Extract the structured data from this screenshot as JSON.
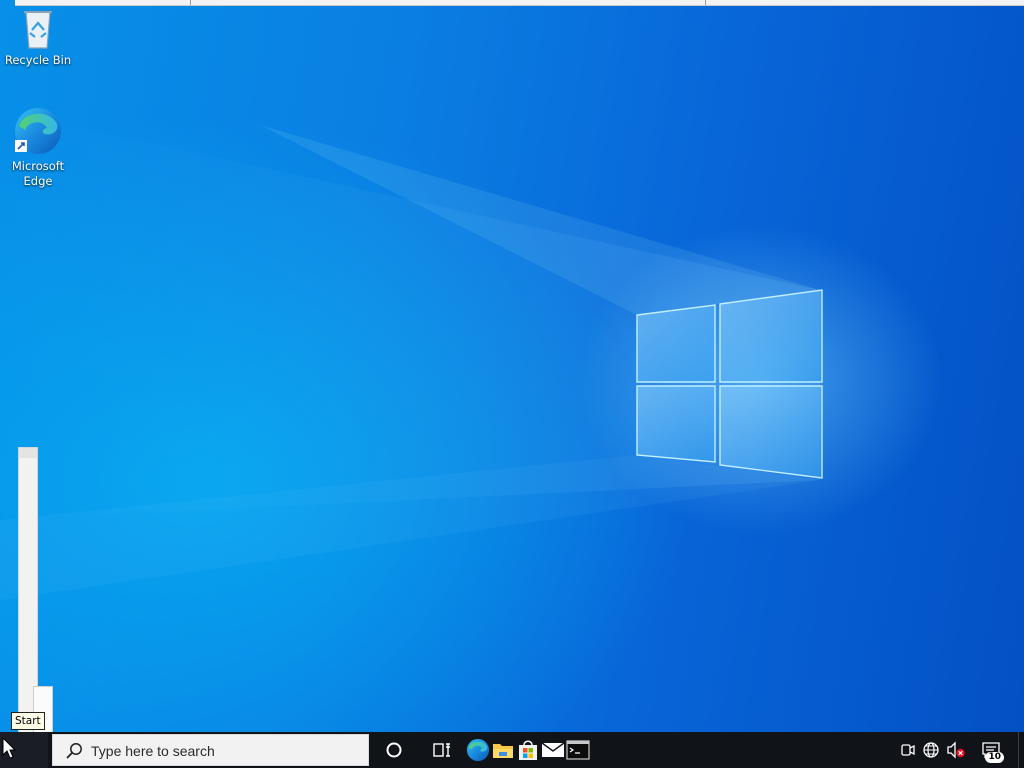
{
  "desktop": {
    "icons": [
      {
        "label": "Recycle Bin",
        "icon": "recycle-bin-icon"
      },
      {
        "label": "Microsoft Edge",
        "icon": "edge-icon"
      }
    ]
  },
  "tooltip": {
    "text": "Start"
  },
  "taskbar": {
    "start_icon": "start-icon",
    "search": {
      "placeholder": "Type here to search"
    },
    "buttons": [
      {
        "icon": "cortana-icon"
      },
      {
        "icon": "task-view-icon"
      }
    ],
    "pinned": [
      {
        "icon": "edge-icon"
      },
      {
        "icon": "file-explorer-icon"
      },
      {
        "icon": "store-icon"
      },
      {
        "icon": "mail-icon"
      },
      {
        "icon": "command-prompt-icon"
      }
    ],
    "tray": {
      "items": [
        {
          "icon": "meet-now-icon"
        },
        {
          "icon": "network-icon"
        },
        {
          "icon": "volume-muted-icon"
        }
      ],
      "notification_count": "10"
    }
  },
  "colors": {
    "wallpaper_accent": "#0a7fe2",
    "taskbar": "#101318",
    "search_bg": "#f2f2f2"
  }
}
